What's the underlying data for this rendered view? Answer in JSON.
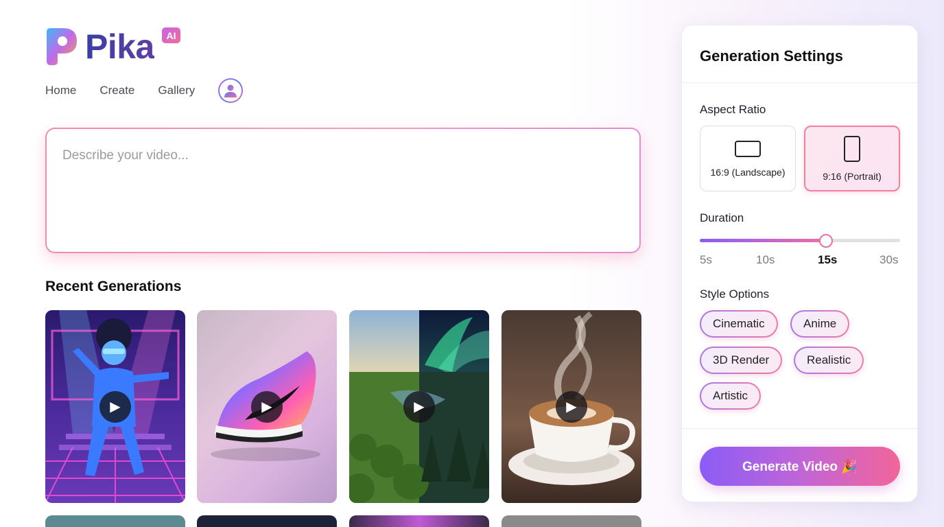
{
  "brand": {
    "name": "Pika",
    "badge": "AI"
  },
  "nav": {
    "items": [
      {
        "label": "Home"
      },
      {
        "label": "Create"
      },
      {
        "label": "Gallery"
      }
    ]
  },
  "prompt": {
    "placeholder": "Describe your video..."
  },
  "recent": {
    "title": "Recent Generations",
    "cards": [
      {
        "subject": "disco-dancer"
      },
      {
        "subject": "sneaker"
      },
      {
        "subject": "forest-aurora"
      },
      {
        "subject": "coffee-cup"
      }
    ]
  },
  "settings": {
    "title": "Generation Settings",
    "aspect_ratio": {
      "label": "Aspect Ratio",
      "options": [
        {
          "label": "16:9 (Landscape)",
          "icon": "landscape-icon"
        },
        {
          "label": "9:16 (Portrait)",
          "icon": "portrait-icon",
          "selected": true
        }
      ]
    },
    "duration": {
      "label": "Duration",
      "ticks": [
        "5s",
        "10s",
        "15s",
        "30s"
      ],
      "selected": "15s"
    },
    "style": {
      "label": "Style Options",
      "chips": [
        "Cinematic",
        "Anime",
        "3D Render",
        "Realistic",
        "Artistic"
      ]
    },
    "generate_label": "Generate Video 🎉"
  },
  "colors": {
    "accent_purple": "#8b5cf6",
    "accent_pink": "#f2659a",
    "brand_text": "#3a3fa8"
  }
}
